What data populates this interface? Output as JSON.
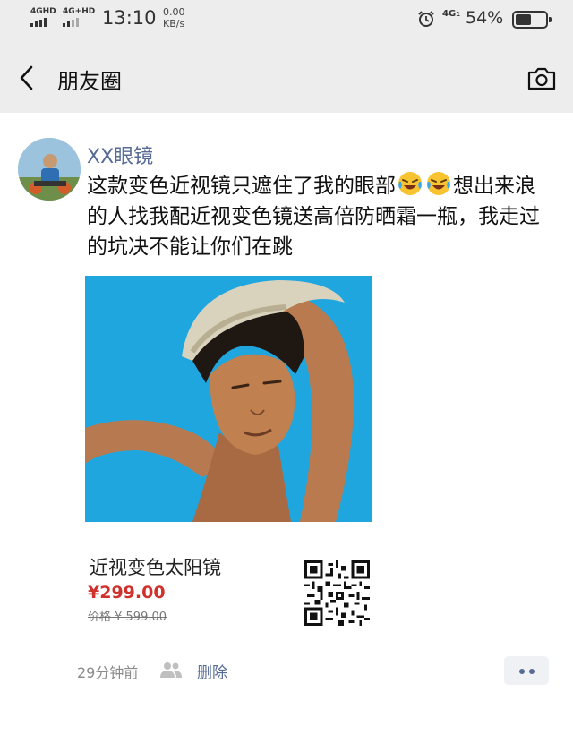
{
  "status_bar": {
    "sim1": "4GHD",
    "sim2": "4G+HD",
    "time": "13:10",
    "speed_value": "0.00",
    "speed_unit": "KB/s",
    "network": "4G",
    "battery_percent": "54%",
    "battery_level": 0.54,
    "icons": [
      "alarm-clock-icon",
      "battery-icon",
      "signal-icon"
    ]
  },
  "nav": {
    "title": "朋友圈",
    "back_icon": "chevron-left-icon",
    "camera_icon": "camera-icon"
  },
  "post": {
    "author": "XX眼镜",
    "text_part1": "这款变色近视镜只遮住了我的眼部",
    "text_part2": "想出来浪的人找我配近视变色镜送高倍防晒霜一瓶，我走过的坑决不能让你们在跳",
    "emojis": [
      "laughing-crying-emoji",
      "laughing-crying-emoji"
    ],
    "product_name": "近视变色太阳镜",
    "price": "¥299.00",
    "original_price": "价格 ¥ 599.00",
    "timestamp": "29分钟前",
    "delete_label": "删除",
    "colors": {
      "link": "#576b95",
      "price": "#d0312d",
      "header_bg": "#ededed"
    }
  }
}
